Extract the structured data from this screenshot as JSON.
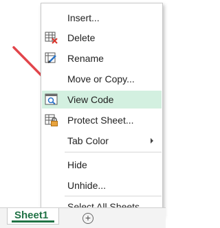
{
  "context_menu": {
    "items": [
      {
        "label": "Insert...",
        "icon": "none",
        "active": false
      },
      {
        "label": "Delete",
        "icon": "delete-sheet-icon",
        "active": false
      },
      {
        "label": "Rename",
        "icon": "rename-sheet-icon",
        "active": false
      },
      {
        "label": "Move or Copy...",
        "icon": "none",
        "active": false
      },
      {
        "label": "View Code",
        "icon": "view-code-icon",
        "active": true
      },
      {
        "label": "Protect Sheet...",
        "icon": "protect-sheet-icon",
        "active": false
      },
      {
        "label": "Tab Color",
        "icon": "none",
        "active": false,
        "submenu": true
      },
      {
        "label": "Hide",
        "icon": "none",
        "active": false
      },
      {
        "label": "Unhide...",
        "icon": "none",
        "active": false
      },
      {
        "label": "Select All Sheets",
        "icon": "none",
        "active": false
      }
    ]
  },
  "sheet_tabs": {
    "active_label": "Sheet1",
    "add_button": "+"
  },
  "colors": {
    "highlight": "#d3f0e0",
    "arrow": "#e2454b",
    "excel_green": "#207245"
  }
}
